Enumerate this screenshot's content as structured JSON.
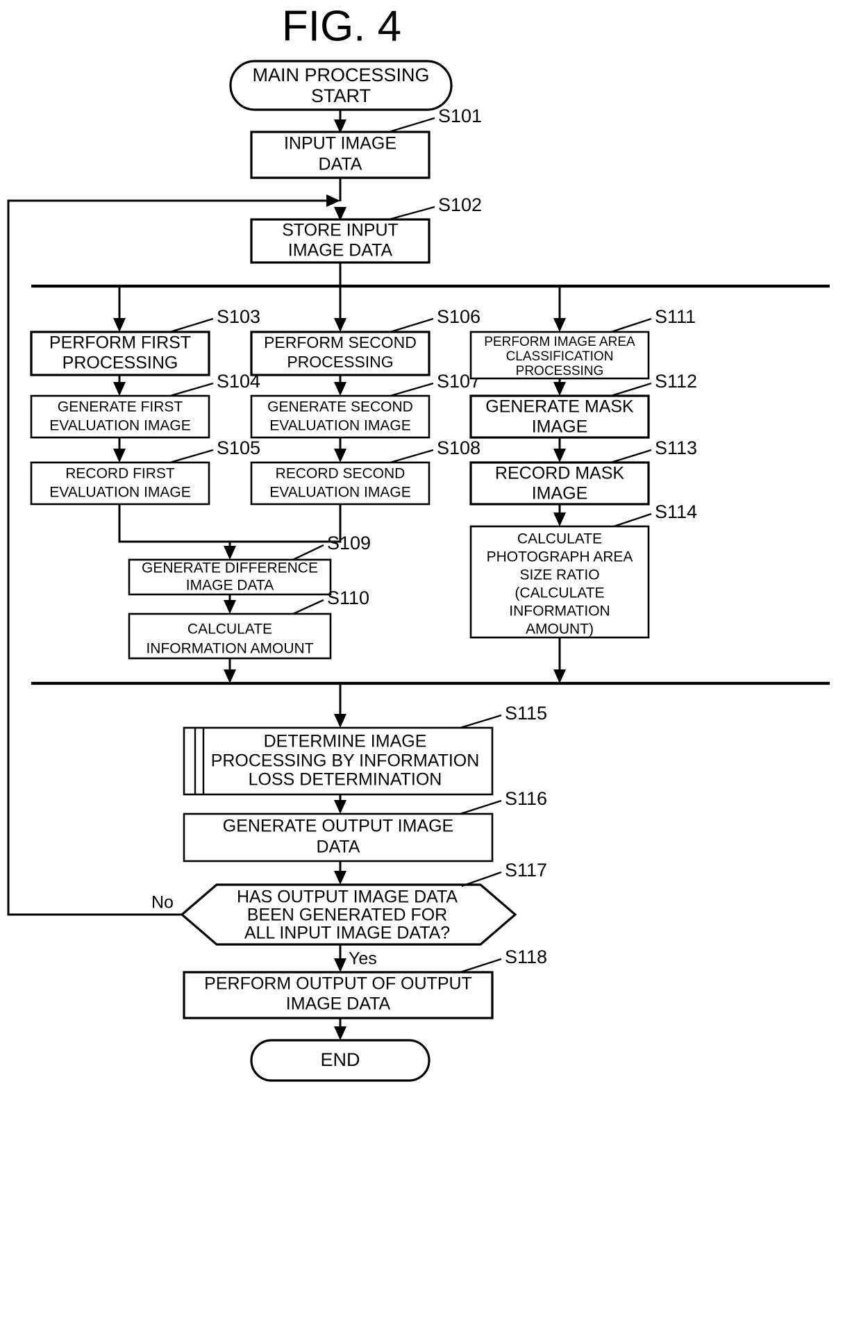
{
  "figure": {
    "title": "FIG. 4"
  },
  "nodes": {
    "start": {
      "label_line1": "MAIN PROCESSING",
      "label_line2": "START"
    },
    "s101": {
      "step": "S101",
      "label_line1": "INPUT IMAGE",
      "label_line2": "DATA"
    },
    "s102": {
      "step": "S102",
      "label_line1": "STORE INPUT",
      "label_line2": "IMAGE DATA"
    },
    "s103": {
      "step": "S103",
      "label_line1": "PERFORM FIRST",
      "label_line2": "PROCESSING"
    },
    "s104": {
      "step": "S104",
      "label_line1": "GENERATE FIRST",
      "label_line2": "EVALUATION IMAGE"
    },
    "s105": {
      "step": "S105",
      "label_line1": "RECORD FIRST",
      "label_line2": "EVALUATION IMAGE"
    },
    "s106": {
      "step": "S106",
      "label_line1": "PERFORM SECOND",
      "label_line2": "PROCESSING"
    },
    "s107": {
      "step": "S107",
      "label_line1": "GENERATE SECOND",
      "label_line2": "EVALUATION IMAGE"
    },
    "s108": {
      "step": "S108",
      "label_line1": "RECORD SECOND",
      "label_line2": "EVALUATION IMAGE"
    },
    "s109": {
      "step": "S109",
      "label_line1": "GENERATE DIFFERENCE",
      "label_line2": "IMAGE DATA"
    },
    "s110": {
      "step": "S110",
      "label_line1": "CALCULATE",
      "label_line2": "INFORMATION AMOUNT"
    },
    "s111": {
      "step": "S111",
      "label_line1": "PERFORM IMAGE AREA",
      "label_line2": "CLASSIFICATION",
      "label_line3": "PROCESSING"
    },
    "s112": {
      "step": "S112",
      "label_line1": "GENERATE MASK",
      "label_line2": "IMAGE"
    },
    "s113": {
      "step": "S113",
      "label_line1": "RECORD MASK",
      "label_line2": "IMAGE"
    },
    "s114": {
      "step": "S114",
      "label_line1": "CALCULATE",
      "label_line2": "PHOTOGRAPH AREA",
      "label_line3": "SIZE RATIO",
      "label_line4": "(CALCULATE",
      "label_line5": "INFORMATION",
      "label_line6": "AMOUNT)"
    },
    "s115": {
      "step": "S115",
      "label_line1": "DETERMINE IMAGE",
      "label_line2": "PROCESSING BY INFORMATION",
      "label_line3": "LOSS DETERMINATION"
    },
    "s116": {
      "step": "S116",
      "label_line1": "GENERATE OUTPUT IMAGE",
      "label_line2": "DATA"
    },
    "s117": {
      "step": "S117",
      "label_line1": "HAS OUTPUT IMAGE DATA",
      "label_line2": "BEEN GENERATED FOR",
      "label_line3": "ALL INPUT IMAGE DATA?",
      "branch_no": "No",
      "branch_yes": "Yes"
    },
    "s118": {
      "step": "S118",
      "label_line1": "PERFORM OUTPUT OF OUTPUT",
      "label_line2": "IMAGE DATA"
    },
    "end": {
      "label": "END"
    }
  },
  "colors": {
    "stroke": "#000000",
    "fill": "#ffffff"
  }
}
